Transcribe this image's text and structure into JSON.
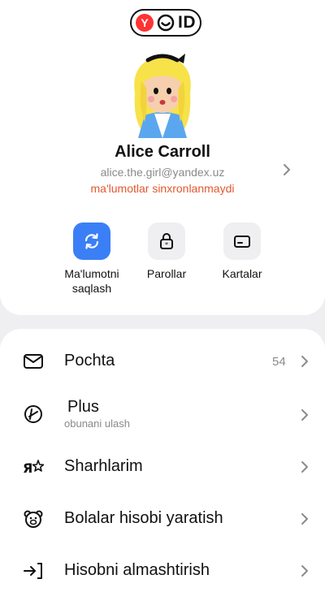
{
  "header": {
    "logo_ya": "Y",
    "logo_id": "ID"
  },
  "profile": {
    "name": "Alice Carroll",
    "email": "alice.the.girl@yandex.uz",
    "sync_status": "ma'lumotlar sinxronlanmaydi"
  },
  "actions": [
    {
      "label": "Ma'lumotni\nsaqlash",
      "icon": "sync-icon"
    },
    {
      "label": "Parollar",
      "icon": "lock-icon"
    },
    {
      "label": "Kartalar",
      "icon": "card-icon"
    }
  ],
  "menu": [
    {
      "label": "Pochta",
      "badge": "54",
      "icon": "mail-icon"
    },
    {
      "label": "Plus",
      "sublabel": "obunani ulash",
      "icon": "plus-icon"
    },
    {
      "label": "Sharhlarim",
      "icon": "reviews-icon"
    },
    {
      "label": "Bolalar hisobi yaratish",
      "icon": "bear-icon"
    },
    {
      "label": "Hisobni almashtirish",
      "icon": "switch-account-icon"
    }
  ],
  "colors": {
    "accent": "#3a7ff5",
    "warning": "#e4572e",
    "background": "#efeff2"
  }
}
